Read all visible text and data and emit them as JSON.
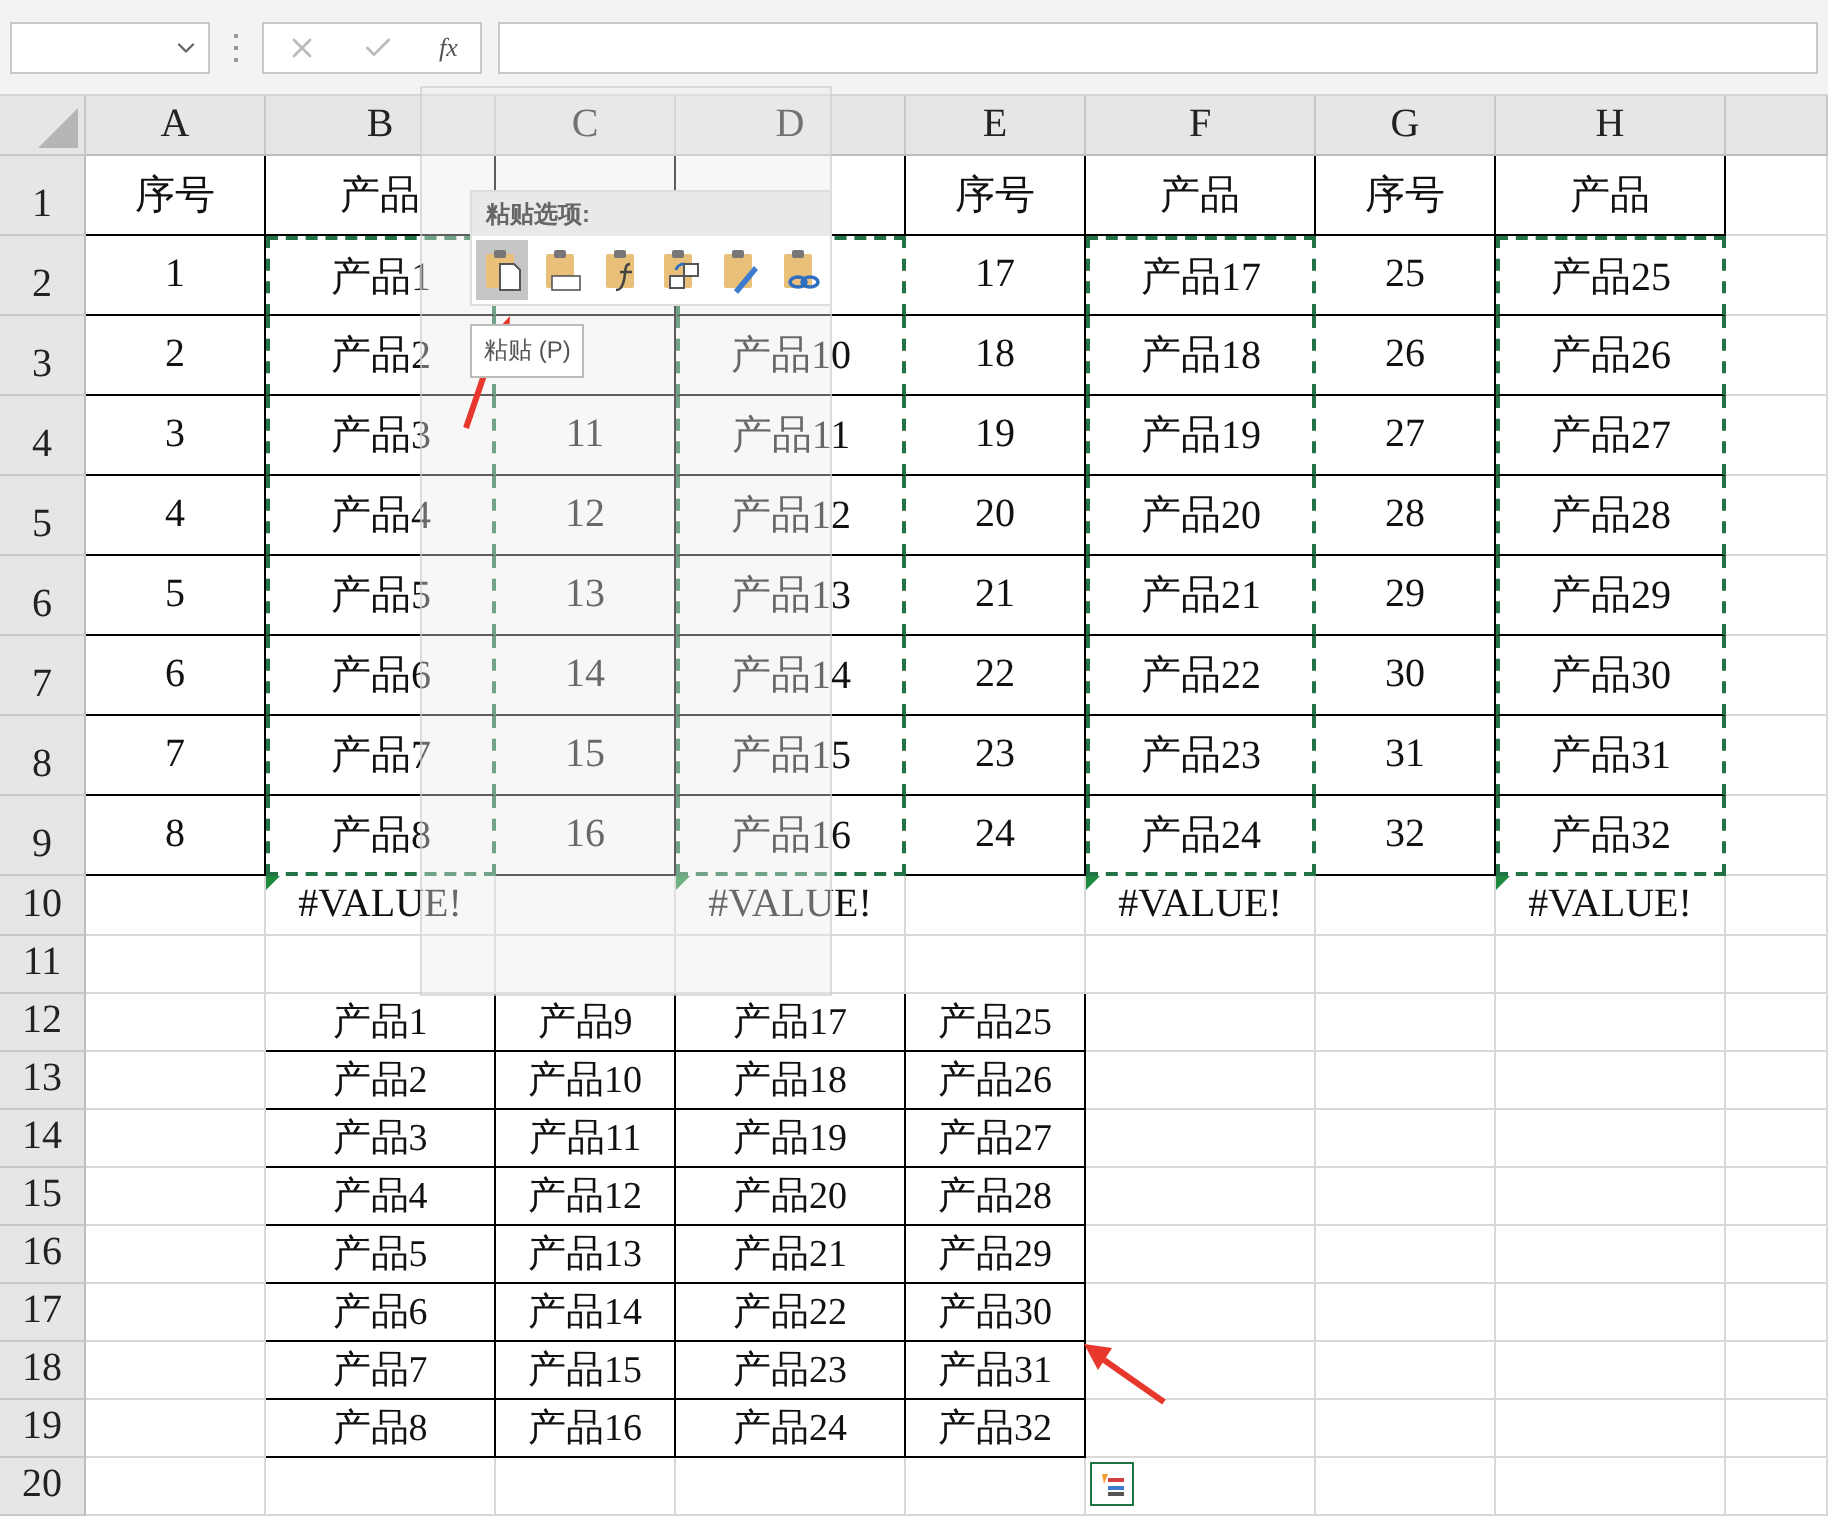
{
  "formula_bar": {
    "function_button": "fx"
  },
  "columns": [
    {
      "label": "A"
    },
    {
      "label": "B",
      "copied": true
    },
    {
      "label": "C"
    },
    {
      "label": "D",
      "copied": true
    },
    {
      "label": "E"
    },
    {
      "label": "F",
      "copied": true
    },
    {
      "label": "G"
    },
    {
      "label": "H",
      "copied": true
    }
  ],
  "rows": [
    {
      "label": "1",
      "kind": "table",
      "cells": {
        "A": "序号",
        "B": "产品",
        "E": "序号",
        "F": "产品",
        "G": "序号",
        "H": "产品"
      }
    },
    {
      "label": "2",
      "kind": "table",
      "copied": true,
      "cells": {
        "A": "1",
        "B": "产品1",
        "E": "17",
        "F": "产品17",
        "G": "25",
        "H": "产品25"
      }
    },
    {
      "label": "3",
      "kind": "table",
      "copied": true,
      "cells": {
        "A": "2",
        "B": "产品2",
        "D": "产品10",
        "E": "18",
        "F": "产品18",
        "G": "26",
        "H": "产品26"
      }
    },
    {
      "label": "4",
      "kind": "table",
      "copied": true,
      "cells": {
        "A": "3",
        "B": "产品3",
        "C": "11",
        "D": "产品11",
        "E": "19",
        "F": "产品19",
        "G": "27",
        "H": "产品27"
      }
    },
    {
      "label": "5",
      "kind": "table",
      "copied": true,
      "cells": {
        "A": "4",
        "B": "产品4",
        "C": "12",
        "D": "产品12",
        "E": "20",
        "F": "产品20",
        "G": "28",
        "H": "产品28"
      }
    },
    {
      "label": "6",
      "kind": "table",
      "copied": true,
      "cells": {
        "A": "5",
        "B": "产品5",
        "C": "13",
        "D": "产品13",
        "E": "21",
        "F": "产品21",
        "G": "29",
        "H": "产品29"
      }
    },
    {
      "label": "7",
      "kind": "table",
      "copied": true,
      "cells": {
        "A": "6",
        "B": "产品6",
        "C": "14",
        "D": "产品14",
        "E": "22",
        "F": "产品22",
        "G": "30",
        "H": "产品30"
      }
    },
    {
      "label": "8",
      "kind": "table",
      "copied": true,
      "cells": {
        "A": "7",
        "B": "产品7",
        "C": "15",
        "D": "产品15",
        "E": "23",
        "F": "产品23",
        "G": "31",
        "H": "产品31"
      }
    },
    {
      "label": "9",
      "kind": "table",
      "copied": true,
      "cells": {
        "A": "8",
        "B": "产品8",
        "C": "16",
        "D": "产品16",
        "E": "24",
        "F": "产品24",
        "G": "32",
        "H": "产品32"
      }
    },
    {
      "label": "10",
      "kind": "plain",
      "error_flags": true,
      "cells": {
        "B": "#VALUE!",
        "D": "#VALUE!",
        "F": "#VALUE!",
        "H": "#VALUE!"
      }
    },
    {
      "label": "11",
      "kind": "plain",
      "cells": {}
    },
    {
      "label": "12",
      "kind": "list",
      "cells": {
        "B": "产品1",
        "C": "产品9",
        "D": "产品17",
        "E": "产品25"
      }
    },
    {
      "label": "13",
      "kind": "list",
      "cells": {
        "B": "产品2",
        "C": "产品10",
        "D": "产品18",
        "E": "产品26"
      }
    },
    {
      "label": "14",
      "kind": "list",
      "cells": {
        "B": "产品3",
        "C": "产品11",
        "D": "产品19",
        "E": "产品27"
      }
    },
    {
      "label": "15",
      "kind": "list",
      "cells": {
        "B": "产品4",
        "C": "产品12",
        "D": "产品20",
        "E": "产品28"
      }
    },
    {
      "label": "16",
      "kind": "list",
      "cells": {
        "B": "产品5",
        "C": "产品13",
        "D": "产品21",
        "E": "产品29"
      }
    },
    {
      "label": "17",
      "kind": "list",
      "cells": {
        "B": "产品6",
        "C": "产品14",
        "D": "产品22",
        "E": "产品30"
      }
    },
    {
      "label": "18",
      "kind": "list",
      "cells": {
        "B": "产品7",
        "C": "产品15",
        "D": "产品23",
        "E": "产品31"
      }
    },
    {
      "label": "19",
      "kind": "list",
      "cells": {
        "B": "产品8",
        "C": "产品16",
        "D": "产品24",
        "E": "产品32"
      }
    },
    {
      "label": "20",
      "kind": "plain",
      "cells": {}
    }
  ],
  "paste_popup": {
    "title": "粘贴选项:",
    "options": [
      {
        "kind": "paste",
        "selected": true
      },
      {
        "kind": "values",
        "selected": false
      },
      {
        "kind": "formulas",
        "selected": false
      },
      {
        "kind": "transpose",
        "selected": false
      },
      {
        "kind": "formatting",
        "selected": false
      },
      {
        "kind": "link",
        "selected": false
      }
    ],
    "tooltip": "粘贴 (P)"
  }
}
